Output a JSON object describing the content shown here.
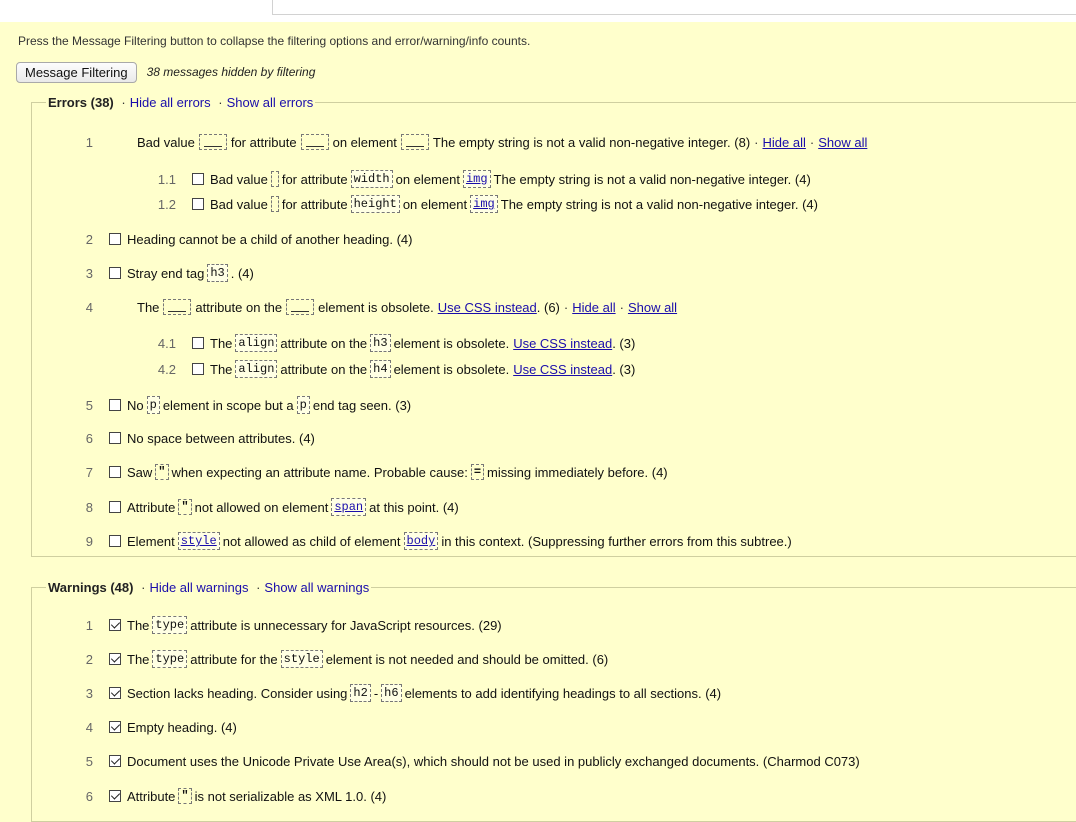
{
  "intro_text": "Press the Message Filtering button to collapse the filtering options and error/warning/info counts.",
  "filter_button": "Message Filtering",
  "hidden_note": "38 messages hidden by filtering",
  "errors": {
    "count_label": "Errors (38)",
    "hide_all": "Hide all errors",
    "show_all": "Show all errors",
    "dot": "·",
    "hide_short": "Hide all",
    "show_short": "Show all",
    "items": {
      "e1": {
        "num": "1",
        "t1": "Bad value",
        "t2": "for attribute",
        "t3": "on element",
        "t4": "The empty string is not a valid non-negative integer. (8)",
        "dot": "·"
      },
      "e1_1": {
        "num": "1.1",
        "t1": "Bad value",
        "t2": "for attribute",
        "code1": "width",
        "t3": "on element",
        "code2": "img",
        "t4": "The empty string is not a valid non-negative integer. (4)"
      },
      "e1_2": {
        "num": "1.2",
        "t1": "Bad value",
        "t2": "for attribute",
        "code1": "height",
        "t3": "on element",
        "code2": "img",
        "t4": "The empty string is not a valid non-negative integer. (4)"
      },
      "e2": {
        "num": "2",
        "t1": "Heading cannot be a child of another heading. (4)"
      },
      "e3": {
        "num": "3",
        "t1": "Stray end tag",
        "code1": "h3",
        "t2": ". (4)"
      },
      "e4": {
        "num": "4",
        "t1": "The",
        "t2": "attribute on the",
        "t3": "element is obsolete.",
        "link": "Use CSS instead",
        "t4": ". (6)",
        "dot": "·"
      },
      "e4_1": {
        "num": "4.1",
        "t1": "The",
        "code1": "align",
        "t2": "attribute on the",
        "code2": "h3",
        "t3": "element is obsolete.",
        "link": "Use CSS instead",
        "t4": ". (3)"
      },
      "e4_2": {
        "num": "4.2",
        "t1": "The",
        "code1": "align",
        "t2": "attribute on the",
        "code2": "h4",
        "t3": "element is obsolete.",
        "link": "Use CSS instead",
        "t4": ". (3)"
      },
      "e5": {
        "num": "5",
        "t1": "No",
        "code1": "p",
        "t2": "element in scope but a",
        "code2": "p",
        "t3": "end tag seen. (3)"
      },
      "e6": {
        "num": "6",
        "t1": "No space between attributes. (4)"
      },
      "e7": {
        "num": "7",
        "t1": "Saw",
        "q1": "\"",
        "t2": "when expecting an attribute name. Probable cause:",
        "q2": "=",
        "t3": "missing immediately before. (4)"
      },
      "e8": {
        "num": "8",
        "t1": "Attribute",
        "q1": "\"",
        "t2": "not allowed on element",
        "code1": "span",
        "t3": "at this point. (4)"
      },
      "e9": {
        "num": "9",
        "t1": "Element",
        "code1": "style",
        "t2": "not allowed as child of element",
        "code2": "body",
        "t3": "in this context. (Suppressing further errors from this subtree.)"
      }
    }
  },
  "warnings": {
    "count_label": "Warnings (48)",
    "hide_all": "Hide all warnings",
    "show_all": "Show all warnings",
    "dot": "·",
    "items": {
      "w1": {
        "num": "1",
        "t1": "The",
        "code1": "type",
        "t2": "attribute is unnecessary for JavaScript resources. (29)"
      },
      "w2": {
        "num": "2",
        "t1": "The",
        "code1": "type",
        "t2": "attribute for the",
        "code2": "style",
        "t3": "element is not needed and should be omitted. (6)"
      },
      "w3": {
        "num": "3",
        "t1": "Section lacks heading. Consider using",
        "code1": "h2",
        "t2": "-",
        "code2": "h6",
        "t3": "elements to add identifying headings to all sections. (4)"
      },
      "w4": {
        "num": "4",
        "t1": "Empty heading. (4)"
      },
      "w5": {
        "num": "5",
        "t1": "Document uses the Unicode Private Use Area(s), which should not be used in publicly exchanged documents. (Charmod C073)"
      },
      "w6": {
        "num": "6",
        "t1": "Attribute",
        "q1": "\"",
        "t2": "is not serializable as XML 1.0. (4)"
      }
    }
  }
}
